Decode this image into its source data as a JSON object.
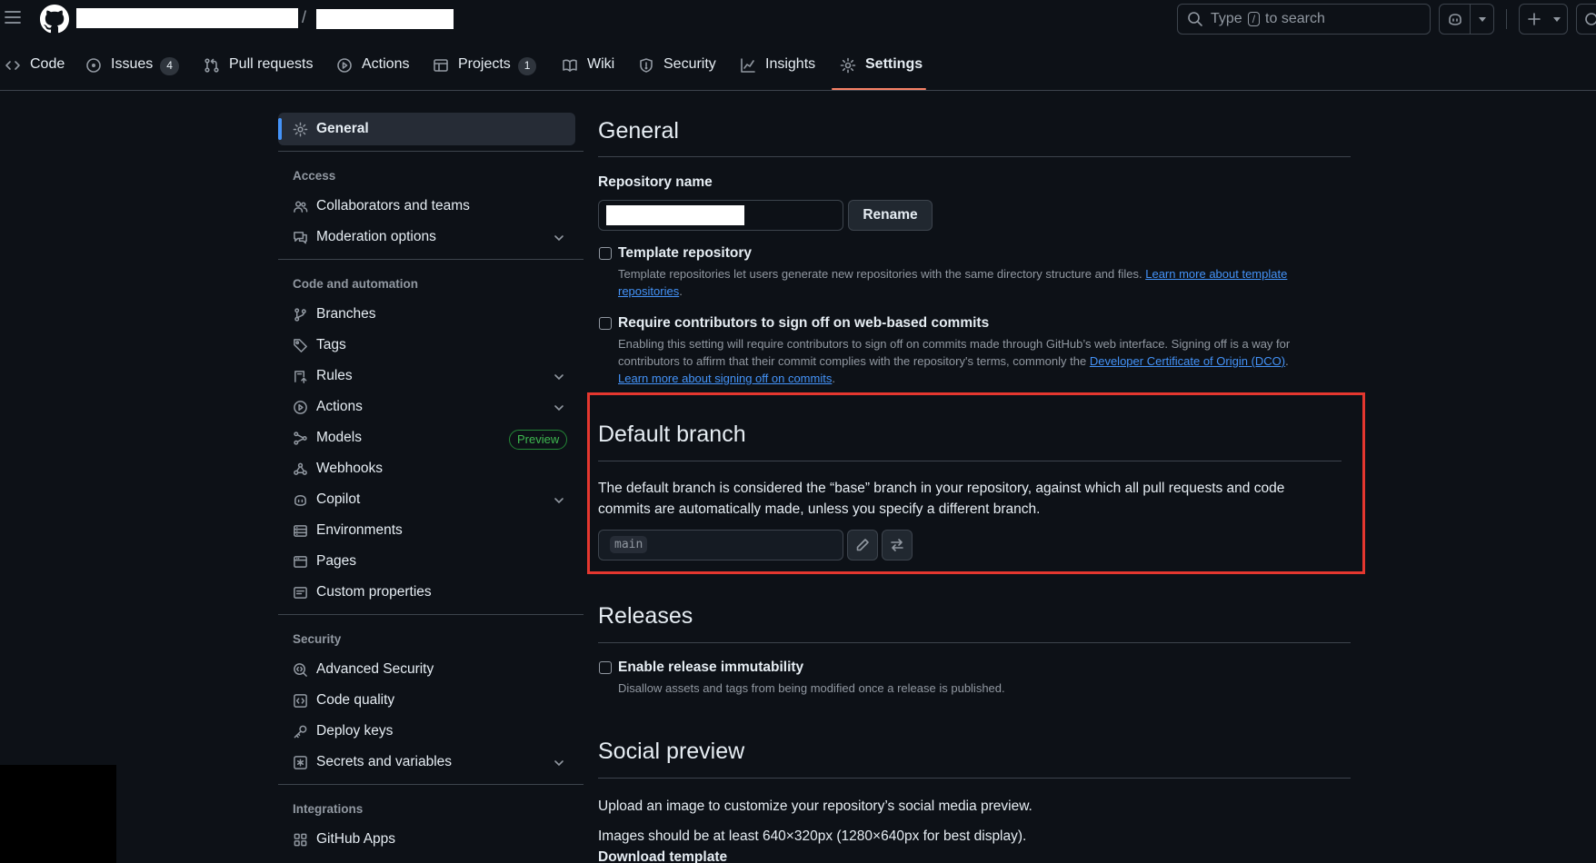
{
  "header": {
    "search_prefix": "Type",
    "search_key": "/",
    "search_suffix": "to search"
  },
  "nav": {
    "tabs": [
      {
        "label": "Code"
      },
      {
        "label": "Issues",
        "count": "4"
      },
      {
        "label": "Pull requests"
      },
      {
        "label": "Actions"
      },
      {
        "label": "Projects",
        "count": "1"
      },
      {
        "label": "Wiki"
      },
      {
        "label": "Security"
      },
      {
        "label": "Insights"
      },
      {
        "label": "Settings",
        "selected": true
      }
    ]
  },
  "sidebar": {
    "general": "General",
    "access_heading": "Access",
    "access": [
      "Collaborators and teams",
      "Moderation options"
    ],
    "code_heading": "Code and automation",
    "code": [
      "Branches",
      "Tags",
      "Rules",
      "Actions",
      "Models",
      "Webhooks",
      "Copilot",
      "Environments",
      "Pages",
      "Custom properties"
    ],
    "preview_badge": "Preview",
    "security_heading": "Security",
    "security": [
      "Advanced Security",
      "Code quality",
      "Deploy keys",
      "Secrets and variables"
    ],
    "integrations_heading": "Integrations",
    "integrations": [
      "GitHub Apps"
    ]
  },
  "main": {
    "general_title": "General",
    "repo_name_label": "Repository name",
    "rename_button": "Rename",
    "template": {
      "title": "Template repository",
      "desc": "Template repositories let users generate new repositories with the same directory structure and files.",
      "link1": "Learn more about template",
      "link2": "repositories",
      "end": "."
    },
    "signoff": {
      "title": "Require contributors to sign off on web-based commits",
      "desc1": "Enabling this setting will require contributors to sign off on commits made through GitHub’s web interface. Signing off is a way for",
      "desc2": "contributors to affirm that their commit complies with the repository's terms, commonly the",
      "dco_link": "Developer Certificate of Origin (DCO)",
      "dot": ".",
      "learn_link": "Learn more about signing off on commits",
      "end": "."
    },
    "default_branch": {
      "title": "Default branch",
      "desc1": "The default branch is considered the “base” branch in your repository, against which all pull requests and code",
      "desc2": "commits are automatically made, unless you specify a different branch.",
      "branch": "main"
    },
    "releases": {
      "title": "Releases",
      "option": "Enable release immutability",
      "desc": "Disallow assets and tags from being modified once a release is published."
    },
    "social": {
      "title": "Social preview",
      "desc1": "Upload an image to customize your repository’s social media preview.",
      "desc2": "Images should be at least 640×320px (1280×640px for best display).",
      "download": "Download template"
    }
  },
  "colors": {
    "background": "#0d1117",
    "accent": "#4493f8",
    "highlight": "#e5372f",
    "tab_underline": "#f78166",
    "success": "#3fb950"
  }
}
